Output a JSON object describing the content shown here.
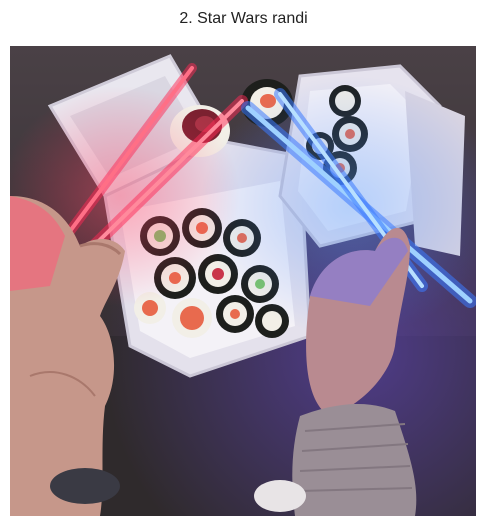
{
  "caption": "2. Star Wars randi",
  "photo": {
    "subject_icons": [
      "sushi-box-left",
      "sushi-box-right",
      "red-light-chopsticks",
      "blue-light-chopsticks",
      "left-hand",
      "right-hand"
    ],
    "colors": {
      "table": "#3a3438",
      "box": "#e9e7ef",
      "red_glow": "#ff2a55",
      "blue_glow": "#3b7bff",
      "sushi_dark": "#1d1f1c",
      "rice": "#f2efe7",
      "salmon": "#e86a4e",
      "skin": "#c6978a",
      "sweater": "#9a8e96"
    }
  }
}
